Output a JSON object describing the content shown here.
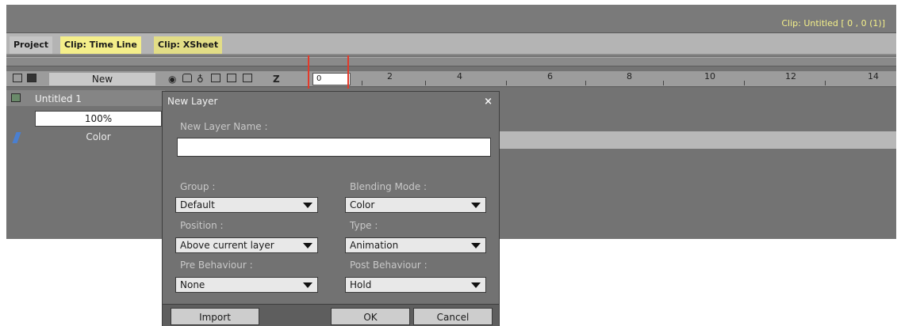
{
  "window": {
    "clip_title": "Clip: Untitled [ 0 , 0  (1)]"
  },
  "tabs": [
    {
      "label": "Project"
    },
    {
      "label": "Clip: Time Line"
    },
    {
      "label": "Clip: XSheet"
    }
  ],
  "toolbar": {
    "new_label": "New",
    "z_label": "Z",
    "frame_value": "0"
  },
  "ruler": {
    "ticks": [
      "2",
      "4",
      "6",
      "8",
      "10",
      "12",
      "14"
    ]
  },
  "layer": {
    "name": "Untitled 1",
    "opacity": "100%",
    "blend": "Color"
  },
  "dialog": {
    "title": "New Layer",
    "close": "×",
    "name_label": "New Layer Name :",
    "name_value": "",
    "group_label": "Group :",
    "group_value": "Default",
    "blend_label": "Blending Mode :",
    "blend_value": "Color",
    "position_label": "Position :",
    "position_value": "Above current layer",
    "type_label": "Type :",
    "type_value": "Animation",
    "pre_label": "Pre Behaviour :",
    "pre_value": "None",
    "post_label": "Post Behaviour :",
    "post_value": "Hold",
    "import_label": "Import",
    "ok_label": "OK",
    "cancel_label": "Cancel"
  },
  "colors": {
    "tab_active": "#f4ee8a",
    "cursor": "#e23a2a",
    "title_text": "#f4f08a"
  }
}
